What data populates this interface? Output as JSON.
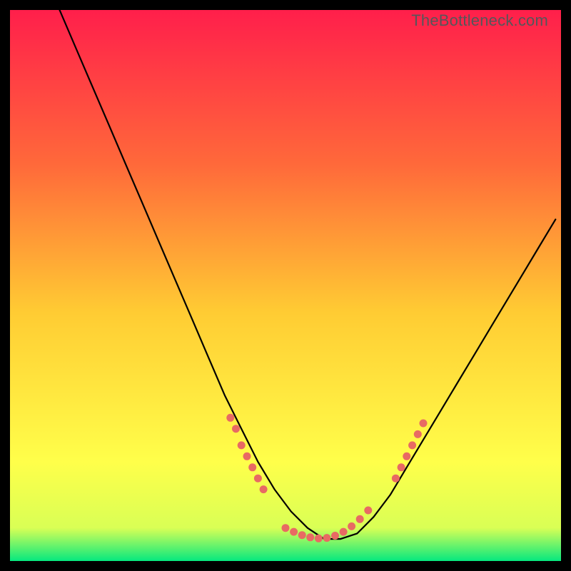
{
  "watermark": "TheBottleneck.com",
  "colors": {
    "gradient_top": "#ff1f4b",
    "gradient_mid1": "#ff693a",
    "gradient_mid2": "#ffcc33",
    "gradient_mid3": "#ffff4a",
    "gradient_bottom": "#06e87f",
    "curve": "#000000",
    "markers": "#e86a63",
    "frame": "#000000"
  },
  "chart_data": {
    "type": "line",
    "title": "",
    "xlabel": "",
    "ylabel": "",
    "xlim": [
      0,
      100
    ],
    "ylim": [
      0,
      100
    ],
    "curve": {
      "name": "bottleneck-curve",
      "x": [
        9,
        12,
        15,
        18,
        21,
        24,
        27,
        30,
        33,
        36,
        39,
        42,
        45,
        48,
        51,
        54,
        57,
        60,
        63,
        66,
        69,
        72,
        75,
        78,
        81,
        84,
        87,
        90,
        93,
        96,
        99
      ],
      "y": [
        100,
        93,
        86,
        79,
        72,
        65,
        58,
        51,
        44,
        37,
        30,
        24,
        18,
        13,
        9,
        6,
        4,
        4,
        5,
        8,
        12,
        17,
        22,
        27,
        32,
        37,
        42,
        47,
        52,
        57,
        62
      ]
    },
    "markers_left": {
      "name": "left-cluster",
      "x": [
        40,
        41,
        42,
        43,
        44,
        45,
        46
      ],
      "y": [
        26,
        24,
        21,
        19,
        17,
        15,
        13
      ]
    },
    "markers_bottom": {
      "name": "bottom-cluster",
      "x": [
        50,
        51.5,
        53,
        54.5,
        56,
        57.5,
        59,
        60.5,
        62,
        63.5,
        65
      ],
      "y": [
        6,
        5.3,
        4.7,
        4.3,
        4.1,
        4.2,
        4.6,
        5.3,
        6.3,
        7.6,
        9.2
      ]
    },
    "markers_right": {
      "name": "right-cluster",
      "x": [
        70,
        71,
        72,
        73,
        74,
        75
      ],
      "y": [
        15,
        17,
        19,
        21,
        23,
        25
      ]
    }
  }
}
